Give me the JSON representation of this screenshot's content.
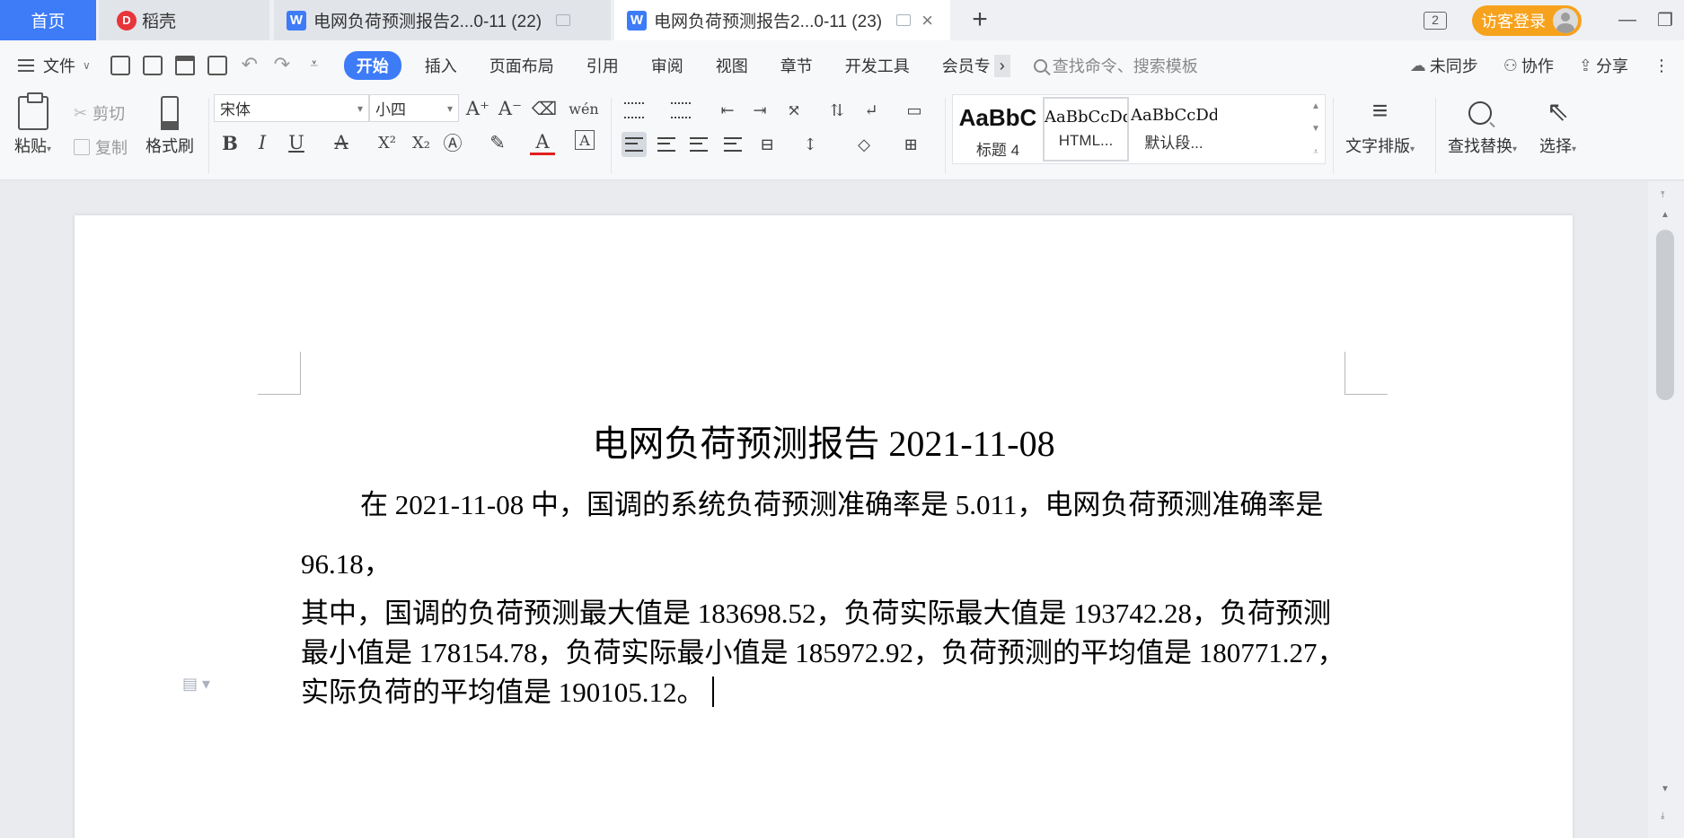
{
  "tabs": {
    "home": "首页",
    "daoke": "稻壳",
    "doc1": "电网负荷预测报告2...0-11 (22)",
    "doc2": "电网负荷预测报告2...0-11 (23)",
    "new_tab": "+"
  },
  "window": {
    "count_badge": "2",
    "login": "访客登录",
    "minimize": "—",
    "restore": "❐"
  },
  "menu": {
    "file": "文件",
    "tabs": [
      "开始",
      "插入",
      "页面布局",
      "引用",
      "审阅",
      "视图",
      "章节",
      "开发工具",
      "会员专"
    ],
    "more": "›",
    "search_placeholder": "查找命令、搜索模板",
    "sync": "未同步",
    "collab": "协作",
    "share": "分享",
    "kebab": "⋮"
  },
  "ribbon": {
    "paste": "粘贴",
    "cut": "剪切",
    "copy": "复制",
    "format_painter": "格式刷",
    "font_name": "宋体",
    "font_size": "小四",
    "bold": "B",
    "italic": "I",
    "underline": "U",
    "strike": "A",
    "superscript": "X²",
    "subscript": "X₂",
    "font_color": "A",
    "grow": "A⁺",
    "shrink": "A⁻",
    "phonetic": "wén",
    "styles": [
      {
        "sample": "AaBbC",
        "name": "标题 4"
      },
      {
        "sample": "AaBbCcDd",
        "name": "HTML..."
      },
      {
        "sample": "AaBbCcDd",
        "name": "默认段..."
      }
    ],
    "text_layout": "文字排版",
    "find_replace": "查找替换",
    "select": "选择"
  },
  "document": {
    "title": "电网负荷预测报告 2021-11-08",
    "para1": "在 2021-11-08 中，国调的系统负荷预测准确率是 5.011，电网负荷预测准确率是 96.18，",
    "para2": "其中，国调的负荷预测最大值是 183698.52，负荷实际最大值是 193742.28，负荷预测最小值是 178154.78，负荷实际最小值是 185972.92，负荷预测的平均值是 180771.27，实际负荷的平均值是 190105.12。"
  },
  "colors": {
    "accent": "#3d7bf7",
    "login": "#f7a21c",
    "daoke": "#e8343b"
  }
}
